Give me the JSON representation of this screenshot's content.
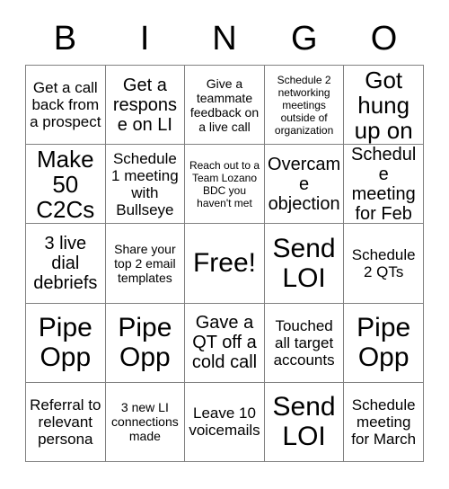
{
  "card": {
    "title": "BINGO",
    "header_letters": [
      "B",
      "I",
      "N",
      "G",
      "O"
    ],
    "columns": 5,
    "rows": 5,
    "border_color": "#808080",
    "text_color": "#000000",
    "background_color": "#ffffff",
    "free_space_index": 12,
    "cells": [
      {
        "text": "Get a call back from a prospect",
        "size": "md"
      },
      {
        "text": "Get a response on LI",
        "size": "lg"
      },
      {
        "text": "Give a teammate feedback on a live call",
        "size": "sm"
      },
      {
        "text": "Schedule 2 networking meetings outside of organization",
        "size": "xs"
      },
      {
        "text": "Got hung up on",
        "size": "xl"
      },
      {
        "text": "Make 50 C2Cs",
        "size": "xl"
      },
      {
        "text": "Schedule 1 meeting with Bullseye",
        "size": "md"
      },
      {
        "text": "Reach out to a Team Lozano BDC you haven't met",
        "size": "xs"
      },
      {
        "text": "Overcame objection",
        "size": "lg"
      },
      {
        "text": "Schedule meeting for Feb",
        "size": "lg"
      },
      {
        "text": "3 live dial debriefs",
        "size": "lg"
      },
      {
        "text": "Share your top 2 email templates",
        "size": "sm"
      },
      {
        "text": "Free!",
        "size": "xxl"
      },
      {
        "text": "Send LOI",
        "size": "xxl"
      },
      {
        "text": "Schedule 2 QTs",
        "size": "md"
      },
      {
        "text": "Pipe Opp",
        "size": "xxl"
      },
      {
        "text": "Pipe Opp",
        "size": "xxl"
      },
      {
        "text": "Gave a QT off a cold call",
        "size": "lg"
      },
      {
        "text": "Touched all target accounts",
        "size": "md"
      },
      {
        "text": "Pipe Opp",
        "size": "xxl"
      },
      {
        "text": "Referral to relevant persona",
        "size": "md"
      },
      {
        "text": "3 new LI connections made",
        "size": "sm"
      },
      {
        "text": "Leave 10 voicemails",
        "size": "md"
      },
      {
        "text": "Send LOI",
        "size": "xxl"
      },
      {
        "text": "Schedule meeting for March",
        "size": "md"
      }
    ]
  }
}
